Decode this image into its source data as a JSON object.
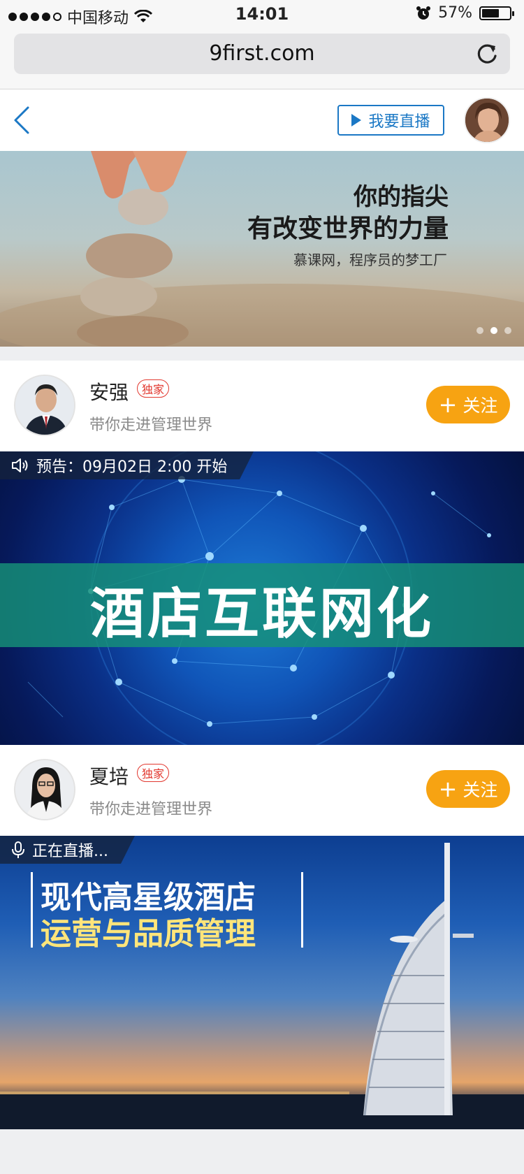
{
  "status_bar": {
    "carrier": "中国移动",
    "time": "14:01",
    "battery_percent": "57%",
    "battery_level": 0.57,
    "signal_dots_filled": 4,
    "signal_dots_total": 5
  },
  "browser": {
    "url": "9first.com",
    "reload_icon": "reload-icon"
  },
  "header": {
    "live_button_label": "我要直播",
    "back_icon": "chevron-left-icon"
  },
  "hero": {
    "title_line1": "你的指尖",
    "title_line2": "有改变世界的力量",
    "subtitle": "慕课网，程序员的梦工厂",
    "active_dot_index": 1,
    "dot_count": 3
  },
  "items": [
    {
      "host_name": "安强",
      "badge": "独家",
      "description": "带你走进管理世界",
      "follow_label": "关注",
      "tag_text": "预告：09月02日 2:00 开始",
      "tag_icon": "speaker-icon",
      "banner_title": "酒店互联网化"
    },
    {
      "host_name": "夏培",
      "badge": "独家",
      "description": "带你走进管理世界",
      "follow_label": "关注",
      "tag_text": "正在直播...",
      "tag_icon": "microphone-icon",
      "banner_title_line1": "现代高星级酒店",
      "banner_title_line2": "运营与品质管理"
    }
  ],
  "colors": {
    "accent_blue": "#1b78c5",
    "follow_orange": "#f7a312",
    "badge_red": "#e2382f"
  }
}
